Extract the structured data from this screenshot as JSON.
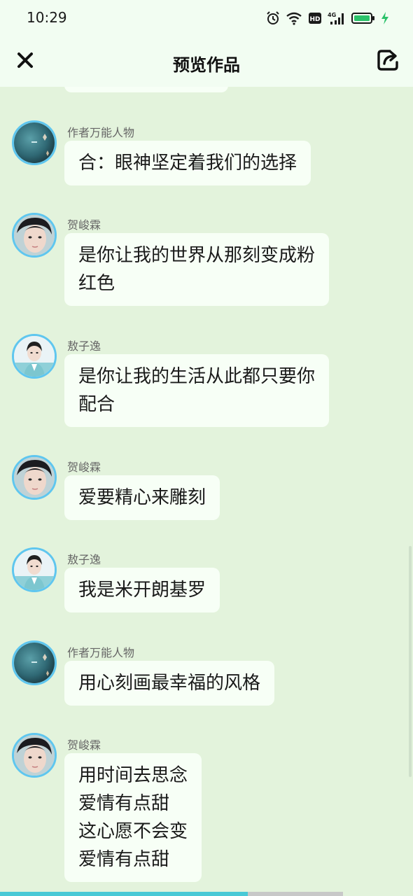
{
  "status_bar": {
    "time": "10:29",
    "icons": [
      "alarm-icon",
      "wifi-icon",
      "hd-icon",
      "signal-4g-icon",
      "battery-icon",
      "charging-icon"
    ],
    "hd_label": "HD",
    "network_label": "4G"
  },
  "header": {
    "title": "预览作品",
    "close_icon": "close-icon",
    "share_icon": "share-icon"
  },
  "messages": [
    {
      "sender": "作者万能人物",
      "avatar": "avatar-author",
      "lines": [
        "合：眼神坚定着我们的选择"
      ]
    },
    {
      "sender": "贺峻霖",
      "avatar": "avatar-hejunlin",
      "lines": [
        "是你让我的世界从那刻变成粉",
        "红色"
      ]
    },
    {
      "sender": "敖子逸",
      "avatar": "avatar-aoziyi",
      "lines": [
        "是你让我的生活从此都只要你",
        "配合"
      ]
    },
    {
      "sender": "贺峻霖",
      "avatar": "avatar-hejunlin",
      "lines": [
        "爱要精心来雕刻"
      ]
    },
    {
      "sender": "敖子逸",
      "avatar": "avatar-aoziyi",
      "lines": [
        "我是米开朗基罗"
      ]
    },
    {
      "sender": "作者万能人物",
      "avatar": "avatar-author",
      "lines": [
        "用心刻画最幸福的风格"
      ]
    },
    {
      "sender": "贺峻霖",
      "avatar": "avatar-hejunlin",
      "lines": [
        "用时间去思念",
        "爱情有点甜",
        "这心愿不会变",
        "爱情有点甜"
      ]
    }
  ],
  "progress": {
    "played_fraction": 0.6,
    "buffered_fraction": 0.83
  },
  "colors": {
    "background": "#e3f3dc",
    "header": "#f2fdf2",
    "bubble": "#f7fff6",
    "avatar_ring": "#5fc6ef",
    "progress": "#49c9d6",
    "battery": "#2bc26a"
  }
}
